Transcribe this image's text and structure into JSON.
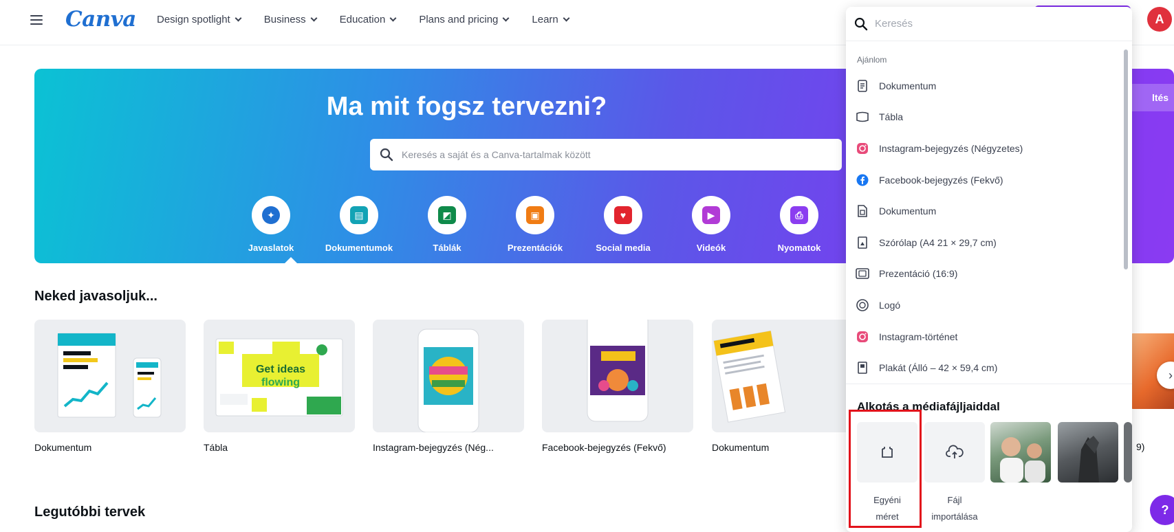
{
  "nav": {
    "logo": "Canva",
    "items": [
      {
        "label": "Design spotlight"
      },
      {
        "label": "Business"
      },
      {
        "label": "Education"
      },
      {
        "label": "Plans and pricing"
      },
      {
        "label": "Learn"
      }
    ],
    "avatar_letter": "A"
  },
  "hero": {
    "title": "Ma mit fogsz tervezni?",
    "search_placeholder": "Keresés a saját és a Canva-tartalmak között",
    "right_button_partial": "ltés",
    "categories": [
      {
        "label": "Javaslatok",
        "icon": "sparkles-icon",
        "color": "#1f6fd1"
      },
      {
        "label": "Dokumentumok",
        "icon": "document-icon",
        "color": "#13a3b5"
      },
      {
        "label": "Táblák",
        "icon": "whiteboard-icon",
        "color": "#0f8a4a"
      },
      {
        "label": "Prezentációk",
        "icon": "presentation-icon",
        "color": "#f07c14"
      },
      {
        "label": "Social media",
        "icon": "heart-icon",
        "color": "#e2242e"
      },
      {
        "label": "Videók",
        "icon": "video-icon",
        "color": "#b13bd6"
      },
      {
        "label": "Nyomatok",
        "icon": "printer-icon",
        "color": "#8b3df0"
      }
    ]
  },
  "recommended": {
    "title": "Neked javasoljuk...",
    "cards": [
      {
        "label": "Dokumentum"
      },
      {
        "label": "Tábla"
      },
      {
        "label": "Instagram-bejegyzés (Nég..."
      },
      {
        "label": "Facebook-bejegyzés (Fekvő)"
      },
      {
        "label": "Dokumentum"
      }
    ],
    "side_text": "9)"
  },
  "recent": {
    "title": "Legutóbbi tervek"
  },
  "dropdown": {
    "search_placeholder": "Keresés",
    "section_label": "Ajánlom",
    "items": [
      {
        "label": "Dokumentum",
        "icon": "document-icon"
      },
      {
        "label": "Tábla",
        "icon": "whiteboard-icon"
      },
      {
        "label": "Instagram-bejegyzés (Négyzetes)",
        "icon": "instagram-icon"
      },
      {
        "label": "Facebook-bejegyzés (Fekvő)",
        "icon": "facebook-icon"
      },
      {
        "label": "Dokumentum",
        "icon": "document-icon"
      },
      {
        "label": "Szórólap (A4 21 × 29,7 cm)",
        "icon": "flyer-icon"
      },
      {
        "label": "Prezentáció (16:9)",
        "icon": "presentation-icon"
      },
      {
        "label": "Logó",
        "icon": "logo-icon"
      },
      {
        "label": "Instagram-történet",
        "icon": "instagram-icon"
      },
      {
        "label": "Plakát (Álló – 42 × 59,4 cm)",
        "icon": "poster-icon"
      }
    ],
    "media_title": "Alkotás a médiafájljaiddal",
    "custom_size": {
      "line1": "Egyéni",
      "line2": "méret"
    },
    "import_file": {
      "line1": "Fájl",
      "line2": "importálása"
    }
  },
  "help": {
    "label": "?"
  }
}
